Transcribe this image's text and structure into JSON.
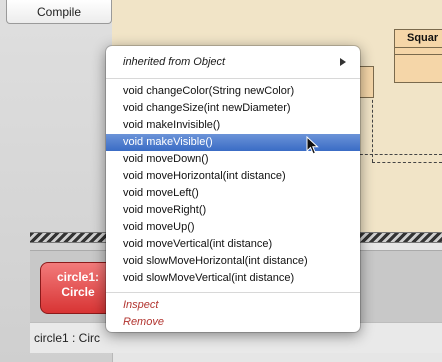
{
  "toolbar": {
    "compile_label": "Compile"
  },
  "diagram": {
    "class_name": "Squar"
  },
  "context_menu": {
    "inherited_label": "inherited from Object",
    "methods": [
      "void changeColor(String newColor)",
      "void changeSize(int newDiameter)",
      "void makeInvisible()",
      "void makeVisible()",
      "void moveDown()",
      "void moveHorizontal(int distance)",
      "void moveLeft()",
      "void moveRight()",
      "void moveUp()",
      "void moveVertical(int distance)",
      "void slowMoveHorizontal(int distance)",
      "void slowMoveVertical(int distance)"
    ],
    "highlighted_index": 3,
    "actions": [
      "Inspect",
      "Remove"
    ]
  },
  "object_bench": {
    "object_line1": "circle1:",
    "object_line2": "Circle"
  },
  "status": {
    "text": "circle1 : Circ"
  }
}
